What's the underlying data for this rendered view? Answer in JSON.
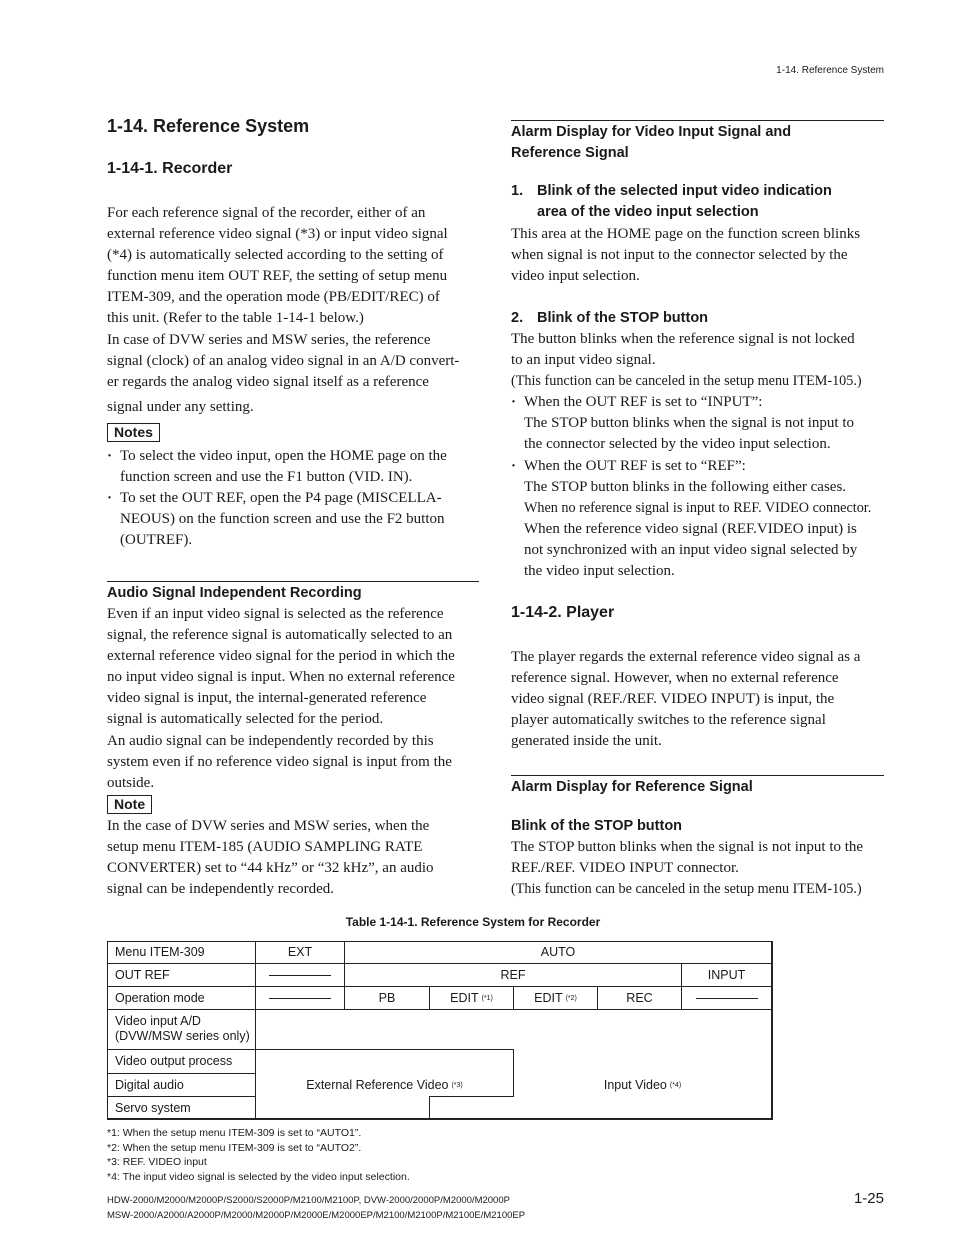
{
  "running_head": "1-14.  Reference System",
  "left": {
    "section_title": "1-14. Reference System",
    "subsection_title": "1-14-1.  Recorder",
    "intro_lines": [
      "For each reference signal of the recorder, either of an",
      "external reference video signal (*3) or input video signal",
      "(*4) is automatically selected according to the setting of",
      "function menu item OUT REF, the setting of setup menu",
      "ITEM-309, and the operation mode (PB/EDIT/REC) of",
      "this unit. (Refer to the table 1-14-1 below.)",
      "In case of DVW series and MSW series, the reference",
      "signal (clock) of an analog video signal in an A/D convert-",
      "er regards the analog video signal itself as a reference",
      "signal under any setting."
    ],
    "notes_label": "Notes",
    "notes": [
      [
        "To select the video input, open the HOME page on the",
        "function screen and use the F1 button (VID. IN)."
      ],
      [
        "To set the OUT REF, open the P4 page (MISCELLA-",
        "NEOUS) on the function screen and use the F2 button",
        "(OUTREF)."
      ]
    ],
    "audio_heading": "Audio Signal Independent Recording",
    "audio_lines": [
      "Even if an input video signal is selected as the reference",
      "signal, the reference signal is automatically selected to an",
      "external reference video signal for the period in which the",
      "no input video signal is input. When no external reference",
      "video signal is input, the internal-generated reference",
      "signal is automatically selected for the period.",
      "An audio signal can be independently recorded by this",
      "system even if no reference video signal is input from the",
      "outside."
    ],
    "note_label": "Note",
    "note_lines": [
      "In the case of DVW series and MSW series, when the",
      "setup menu ITEM-185 (AUDIO SAMPLING RATE",
      "CONVERTER) set to “44 kHz” or “32 kHz”, an audio",
      "signal can be independently recorded."
    ]
  },
  "right": {
    "alarm_heading_lines": [
      "Alarm Display for Video Input Signal and",
      "Reference Signal"
    ],
    "item1_number": "1.",
    "item1_title_lines": [
      "Blink of the selected input video indication",
      "area of the video input selection"
    ],
    "item1_lines": [
      "This area at the HOME page on the function screen blinks",
      "when signal is not input to the connector selected by the",
      "video input selection."
    ],
    "item2_number": "2.",
    "item2_title": "Blink of the STOP button",
    "item2_lines": [
      "The button blinks when the reference signal is not locked",
      "to an input video signal."
    ],
    "item2_cancel": "(This function can be canceled in the setup menu ITEM-105.)",
    "item2_bullets": [
      {
        "lead": "When the OUT REF is set to “INPUT”:",
        "lines": [
          "The STOP button blinks when the signal is not input to",
          "the connector selected by the video input selection."
        ]
      },
      {
        "lead": "When the OUT REF is set to “REF”:",
        "lines": [
          "The STOP button blinks in the following either cases.",
          "When no reference signal is input to REF. VIDEO connector.",
          "When the reference video signal (REF.VIDEO input) is",
          "not synchronized with an input video signal selected by",
          "the video input selection."
        ]
      }
    ],
    "player_title": "1-14-2.  Player",
    "player_lines": [
      "The player regards the external reference video signal as a",
      "reference signal. However, when no external reference",
      "video signal (REF./REF. VIDEO INPUT) is input, the",
      "player automatically switches to the reference signal",
      "generated inside the unit."
    ],
    "alarm_ref_heading": "Alarm Display for Reference Signal",
    "stop_heading": "Blink of the STOP button",
    "stop_lines": [
      "The STOP button blinks when the signal is not input to the",
      "REF./REF. VIDEO INPUT connector.",
      "(This function can be canceled in the setup menu ITEM-105.)"
    ]
  },
  "table": {
    "caption": "Table 1-14-1. Reference System for Recorder",
    "row_labels": [
      "Menu ITEM-309",
      "OUT REF",
      "Operation mode",
      "Video input A/D",
      "(DVW/MSW series only)",
      "Video output process",
      "Digital audio",
      "Servo system"
    ],
    "menu_item_309": {
      "ext": "EXT",
      "auto": "AUTO"
    },
    "out_ref": {
      "ext": "—",
      "ref": "REF",
      "input": "INPUT"
    },
    "operation_mode": {
      "ext": "—",
      "pb": "PB",
      "edit1": "EDIT",
      "edit1_mark": "(*1)",
      "edit2": "EDIT",
      "edit2_mark": "(*2)",
      "rec": "REC",
      "input": "—"
    },
    "external_reference_video": "External Reference Video",
    "external_reference_mark": "(*3)",
    "input_video": "Input Video",
    "input_video_mark": "(*4)"
  },
  "footnotes": [
    "*1: When the setup menu ITEM-309 is set to “AUTO1”.",
    "*2: When the setup menu ITEM-309 is set to “AUTO2”.",
    "*3: REF. VIDEO input",
    "*4: The input video signal is selected by the video input selection."
  ],
  "footer": {
    "models_line1": "HDW-2000/M2000/M2000P/S2000/S2000P/M2100/M2100P, DVW-2000/2000P/M2000/M2000P",
    "models_line2": "MSW-2000/A2000/A2000P/M2000/M2000P/M2000E/M2000EP/M2100/M2100P/M2100E/M2100EP",
    "page_number": "1-25"
  }
}
